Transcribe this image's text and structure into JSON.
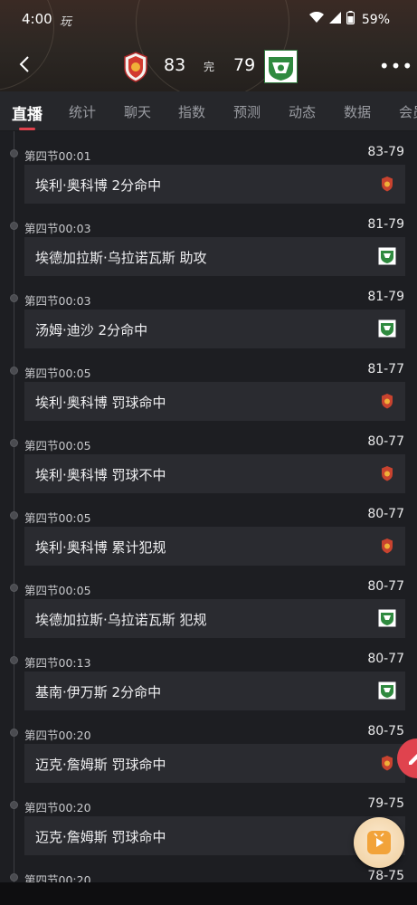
{
  "status_bar": {
    "time": "4:00",
    "app_icon_text": "玩",
    "battery": "59%",
    "icons": [
      "wifi-icon",
      "signal-icon",
      "battery-icon"
    ]
  },
  "match": {
    "home_score": "83",
    "status": "完",
    "away_score": "79",
    "home_logo": "team-logo-red",
    "away_logo": "team-logo-green"
  },
  "tabs": [
    {
      "label": "直播",
      "active": true
    },
    {
      "label": "统计",
      "active": false
    },
    {
      "label": "聊天",
      "active": false
    },
    {
      "label": "指数",
      "active": false
    },
    {
      "label": "预测",
      "active": false
    },
    {
      "label": "动态",
      "active": false
    },
    {
      "label": "数据",
      "active": false
    },
    {
      "label": "会员",
      "active": false
    }
  ],
  "events": [
    {
      "time": "第四节00:01",
      "score": "83-79",
      "text": "埃利·奥科博 2分命中",
      "team": "home"
    },
    {
      "time": "第四节00:03",
      "score": "81-79",
      "text": "埃德加拉斯·乌拉诺瓦斯 助攻",
      "team": "away"
    },
    {
      "time": "第四节00:03",
      "score": "81-79",
      "text": "汤姆·迪沙 2分命中",
      "team": "away"
    },
    {
      "time": "第四节00:05",
      "score": "81-77",
      "text": "埃利·奥科博 罚球命中",
      "team": "home"
    },
    {
      "time": "第四节00:05",
      "score": "80-77",
      "text": "埃利·奥科博 罚球不中",
      "team": "home"
    },
    {
      "time": "第四节00:05",
      "score": "80-77",
      "text": "埃利·奥科博 累计犯规",
      "team": "home"
    },
    {
      "time": "第四节00:05",
      "score": "80-77",
      "text": "埃德加拉斯·乌拉诺瓦斯 犯规",
      "team": "away"
    },
    {
      "time": "第四节00:13",
      "score": "80-77",
      "text": "基南·伊万斯 2分命中",
      "team": "away"
    },
    {
      "time": "第四节00:20",
      "score": "80-75",
      "text": "迈克·詹姆斯 罚球命中",
      "team": "home"
    },
    {
      "time": "第四节00:20",
      "score": "79-75",
      "text": "迈克·詹姆斯 罚球命中",
      "team": "home"
    },
    {
      "time": "第四节00:20",
      "score": "78-75",
      "text": "",
      "team": "home"
    }
  ],
  "colors": {
    "accent": "#e0424d",
    "background": "#1d1e22",
    "card": "#2a2b30"
  }
}
